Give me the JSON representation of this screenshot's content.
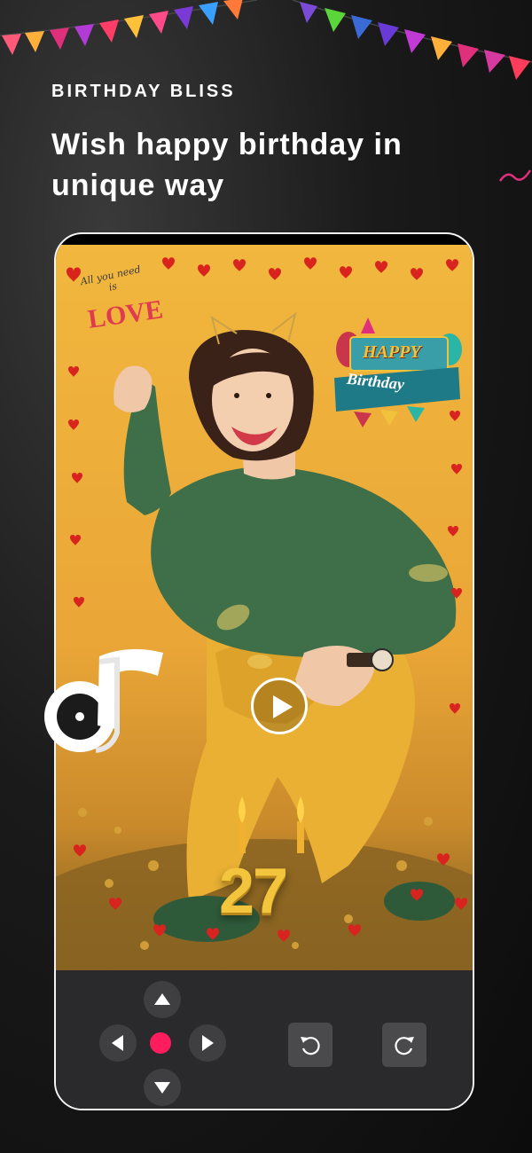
{
  "header": {
    "brand": "BIRTHDAY BLISS",
    "headline": "Wish happy birthday in unique way"
  },
  "preview": {
    "love_sticker_small": "All you need is",
    "love_sticker_word": "LOVE",
    "birthday_sticker_line1": "HAPPY",
    "birthday_sticker_line2": "Birthday",
    "candle_number": "27",
    "play_icon": "play-icon",
    "music_icon": "music-note-icon"
  },
  "controls": {
    "icons": [
      "arrow-up-icon",
      "arrow-left-icon",
      "arrow-right-icon",
      "arrow-down-icon",
      "undo-icon",
      "redo-icon"
    ],
    "center_dot_color": "#ff1d5e"
  },
  "colors": {
    "accent": "#ff1d5e",
    "background": "#111111",
    "photo_backdrop": "#f1b73e",
    "control_panel": "#2a2a2c"
  }
}
